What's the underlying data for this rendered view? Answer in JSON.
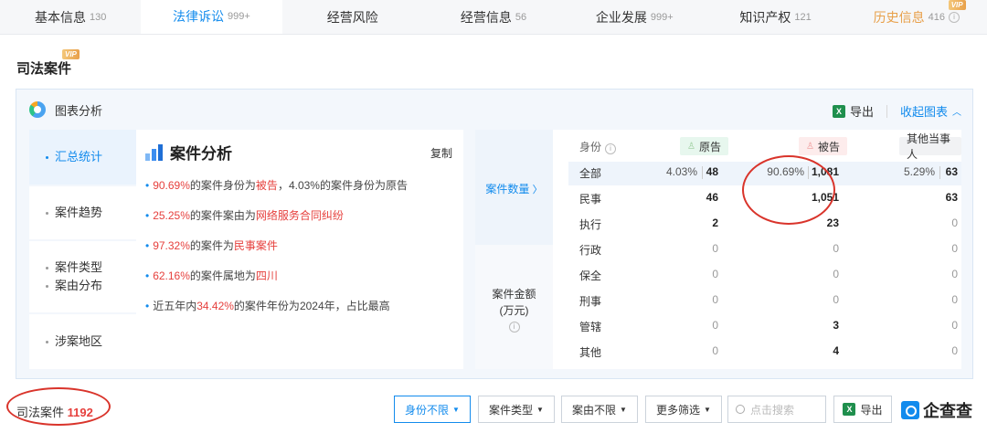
{
  "tabs": [
    {
      "label": "基本信息",
      "count": "130"
    },
    {
      "label": "法律诉讼",
      "count": "999+"
    },
    {
      "label": "经营风险",
      "count": ""
    },
    {
      "label": "经营信息",
      "count": "56"
    },
    {
      "label": "企业发展",
      "count": "999+"
    },
    {
      "label": "知识产权",
      "count": "121"
    },
    {
      "label": "历史信息",
      "count": "416"
    }
  ],
  "vip_label": "VIP",
  "section_title": "司法案件",
  "panel": {
    "title": "图表分析",
    "export_label": "导出",
    "collapse_label": "收起图表"
  },
  "side_nav": [
    "汇总统计",
    "案件趋势",
    "案件类型",
    "案由分布",
    "涉案地区"
  ],
  "analysis": {
    "title": "案件分析",
    "copy_label": "复制",
    "lines": [
      [
        "90.69%",
        "的案件身份为",
        "被告",
        "，4.03%的案件身份为原告"
      ],
      [
        "25.25%",
        "的案件案由为",
        "网络服务合同纠纷",
        ""
      ],
      [
        "97.32%",
        "的案件为",
        "民事案件",
        ""
      ],
      [
        "62.16%",
        "的案件属地为",
        "四川",
        ""
      ],
      [
        "近五年内",
        "34.42%",
        "的案件年份为",
        "2024年，占比最高"
      ]
    ]
  },
  "stats": {
    "identity_header": "身份",
    "columns": [
      "原告",
      "被告",
      "其他当事人"
    ],
    "case_count_label": "案件数量",
    "case_amount_label": "案件金额",
    "case_amount_unit": "(万元)",
    "rows": [
      {
        "name": "全部",
        "pct": [
          "4.03%",
          "90.69%",
          "5.29%"
        ],
        "vals": [
          "48",
          "1,081",
          "63"
        ]
      },
      {
        "name": "民事",
        "vals": [
          "46",
          "1,051",
          "63"
        ]
      },
      {
        "name": "执行",
        "vals": [
          "2",
          "23",
          "0"
        ]
      },
      {
        "name": "行政",
        "vals": [
          "0",
          "0",
          "0"
        ]
      },
      {
        "name": "保全",
        "vals": [
          "0",
          "0",
          "0"
        ]
      },
      {
        "name": "刑事",
        "vals": [
          "0",
          "0",
          "0"
        ]
      },
      {
        "name": "管辖",
        "vals": [
          "0",
          "3",
          "0"
        ]
      },
      {
        "name": "其他",
        "vals": [
          "0",
          "4",
          "0"
        ]
      }
    ]
  },
  "bottom": {
    "title": "司法案件",
    "count": "1192",
    "filters": [
      "身份不限",
      "案件类型",
      "案由不限",
      "更多筛选"
    ],
    "search_placeholder": "点击搜索",
    "export_label": "导出",
    "brand": "企查查"
  },
  "colors": {
    "accent": "#128bed",
    "highlight": "#e6403d",
    "vip": "#e8a04a"
  }
}
